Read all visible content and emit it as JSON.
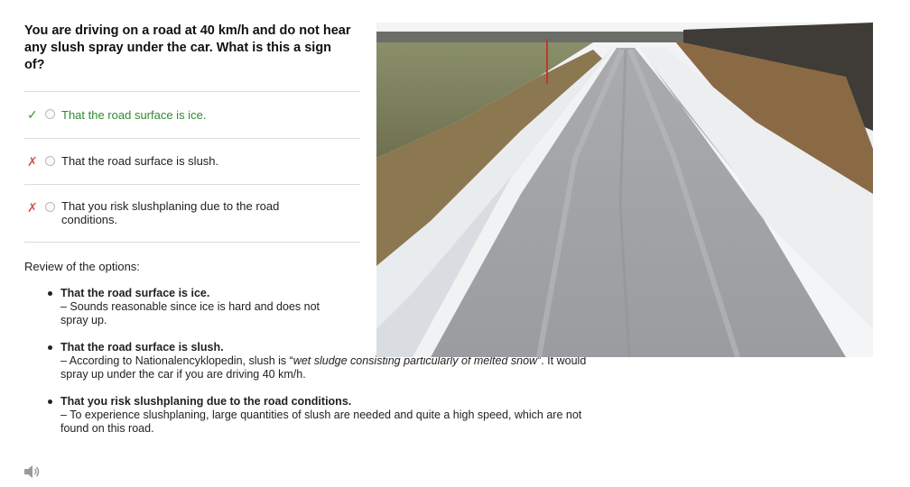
{
  "question": "You are driving on a road at 40 km/h and do not hear any slush spray under the car. What is this a sign of?",
  "options": [
    {
      "text": "That the road surface is ice.",
      "status": "correct",
      "mark": "✓"
    },
    {
      "text": "That the road surface is slush.",
      "status": "wrong",
      "mark": "✗"
    },
    {
      "text": "That you risk slushplaning due to the road conditions.",
      "status": "wrong",
      "mark": "✗"
    }
  ],
  "review": {
    "label": "Review of the options:",
    "items": [
      {
        "title": "That the road surface is ice.",
        "body": "– Sounds reasonable since ice is hard and does not spray up."
      },
      {
        "title": "That the road surface is slush.",
        "body_pre": "– According to Nationalencyklopedin, slush is “",
        "body_em": "wet sludge consisting particularly of melted snow",
        "body_post": "”. It would spray up under the car if you are driving 40 km/h."
      },
      {
        "title": "That you risk slushplaning due to the road conditions.",
        "body": "– To experience slushplaning, large quantities of slush are needed and quite a high speed, which are not found on this road."
      }
    ]
  },
  "colors": {
    "correct": "#2e8b2e",
    "check": "#3a9a2a",
    "cross": "#d9534f",
    "divider": "#dcdcdc"
  },
  "icons": {
    "correct_mark": "check-icon",
    "wrong_mark": "cross-icon",
    "audio": "speaker-icon"
  }
}
